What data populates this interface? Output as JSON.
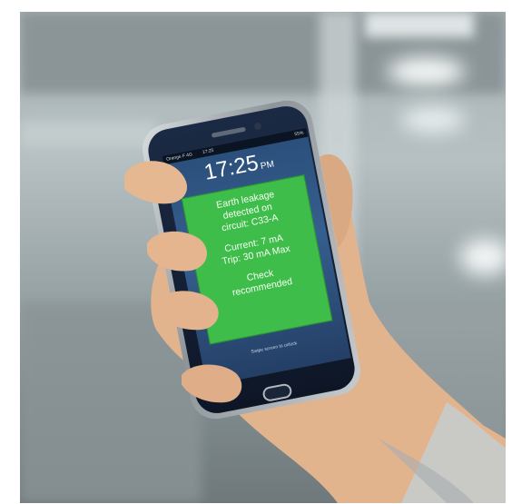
{
  "phone": {
    "status_bar": {
      "carrier": "Orange F  4G",
      "time": "17:25",
      "battery": "55%"
    },
    "clock": {
      "time": "17:25",
      "ampm": "PM"
    },
    "alert": {
      "line1": "Earth leakage",
      "line2": "detected on",
      "line3": "circuit: C33-A",
      "line4": "Current: 7 mA",
      "line5": "Trip: 30 mA Max",
      "line6": "Check",
      "line7": "recommended"
    },
    "swipe_hint": "Swipe screen to unlock"
  },
  "colors": {
    "alert_green": "#3fbd4a",
    "screen_blue": "#2b4e7a"
  },
  "icons": [
    "home-button-icon"
  ]
}
